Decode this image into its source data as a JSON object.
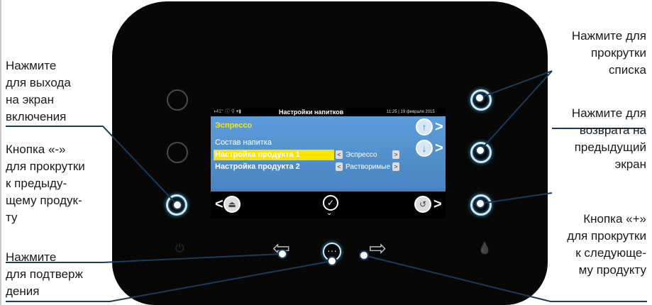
{
  "screen": {
    "status_icons": "◑41° ⓘ  ⚲  ▾▮",
    "title": "Настройки напитков",
    "time": "11:25",
    "date": "19 февраля 2015",
    "heading": "Эспрессо",
    "subheading": "Состав напитка",
    "rows": [
      {
        "label": "Настройка продукта 1",
        "value": "Эспрессо"
      },
      {
        "label": "Настройка продукта 2",
        "value": "Растворимые"
      }
    ],
    "chevron_left": "<",
    "chevron_right": ">",
    "up_icon": "↑",
    "down_icon": "↓",
    "exit_icon": "⏏",
    "check_icon": "✓",
    "down_chevron": "⌄",
    "back_icon": "↺"
  },
  "keys": {
    "power_icon": "⏻",
    "left_arrow": "⇦",
    "menu_icon": "···",
    "right_arrow": "⇨",
    "drop_icon": "💧"
  },
  "callouts": {
    "left_exit": "Нажмите\nдля выхода\nна экран\nвключения",
    "left_minus": "Кнопка «-»\nдля прокрутки\nк предыду-\nщему продук-\nту",
    "left_confirm": "Нажмите\nдля подтверж\nдения",
    "right_scroll": "Нажмите для\nпрокрутки\nсписка",
    "right_back": "Нажмите для\nвозврата на\nпредыдущий\nэкран",
    "right_plus": "Кнопка «+»\nдля прокрутки\nк следующе-\nму продукту"
  },
  "colors": {
    "accent_yellow": "#ffe300",
    "screen_blue": "#4b86c4",
    "glow": "#3fa6cf",
    "leader_line": "#1a3c5c"
  }
}
